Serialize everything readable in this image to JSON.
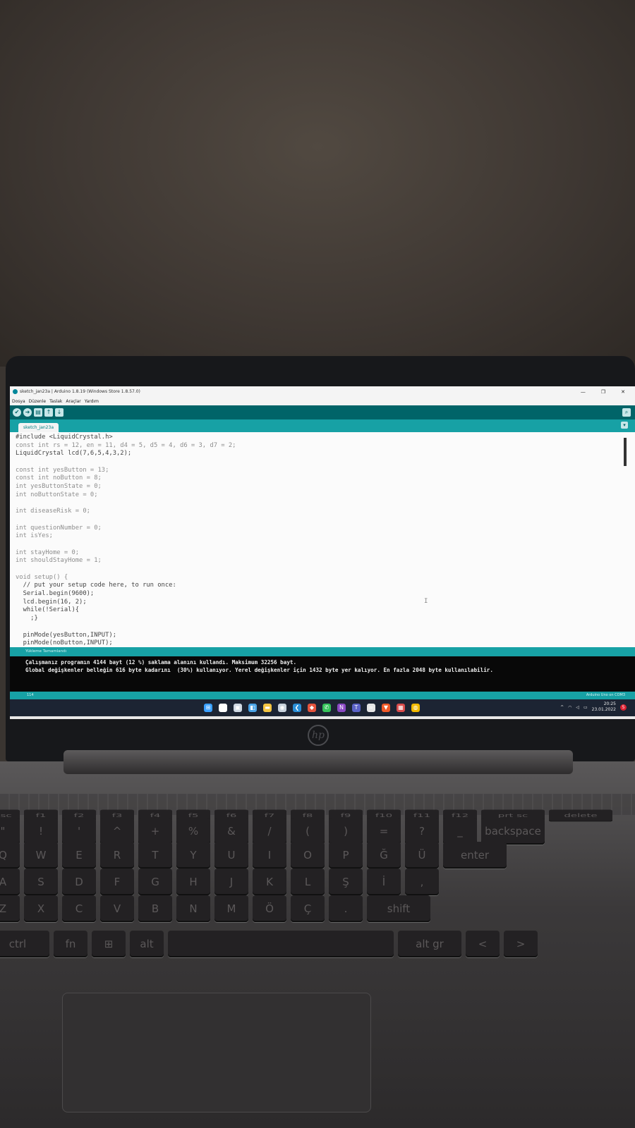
{
  "window": {
    "title": "sketch_jan23a | Arduino 1.8.19 (Windows Store 1.8.57.0)",
    "minimize": "—",
    "maximize": "❐",
    "close": "✕"
  },
  "menu": [
    "Dosya",
    "Düzenle",
    "Taslak",
    "Araçlar",
    "Yardım"
  ],
  "toolbar": {
    "verify_icon": "✔",
    "upload_icon": "➜",
    "new_icon": "▤",
    "open_icon": "↑",
    "save_icon": "↓",
    "serial_icon": "⌕"
  },
  "tab": {
    "label": "sketch_jan23a",
    "menu_icon": "▾"
  },
  "editor": {
    "lines": [
      "#include <LiquidCrystal.h>",
      "const int rs = 12, en = 11, d4 = 5, d5 = 4, d6 = 3, d7 = 2;",
      "LiquidCrystal lcd(7,6,5,4,3,2);",
      "",
      "const int yesButton = 13;",
      "const int noButton = 8;",
      "int yesButtonState = 0;",
      "int noButtonState = 0;",
      "",
      "int diseaseRisk = 0;",
      "",
      "int questionNumber = 0;",
      "int isYes;",
      "",
      "int stayHome = 0;",
      "int shouldStayHome = 1;",
      "",
      "void setup() {",
      "  // put your setup code here, to run once:",
      "  Serial.begin(9600);",
      "  lcd.begin(16, 2);",
      "  while(!Serial){",
      "    ;}",
      "",
      "  pinMode(yesButton,INPUT);",
      "  pinMode(noButton,INPUT);"
    ],
    "cursor_glyph": "I"
  },
  "status": {
    "message": "Yükleme Tamamlandı"
  },
  "console": {
    "lines": [
      "Çalışmanız programın 4144 bayt (12 %) saklama alanını kullandı. Maksimum 32256 bayt.",
      "Global değişkenler belleğin 616 byte kadarını  (30%) kullanıyor. Yerel değişkenler için 1432 byte yer kalıyor. En fazla 2048 byte kullanılabilir."
    ]
  },
  "footer": {
    "line": "114",
    "board": "Arduino Uno on COM3"
  },
  "taskbar": {
    "icons": [
      {
        "name": "windows-start-icon",
        "glyph": "⊞",
        "color": "#3aa0ff"
      },
      {
        "name": "search-icon",
        "glyph": "⌕",
        "color": "#ffffff"
      },
      {
        "name": "task-view-icon",
        "glyph": "▣",
        "color": "#cfd8e3"
      },
      {
        "name": "widgets-icon",
        "glyph": "◧",
        "color": "#4aa3e6"
      },
      {
        "name": "file-explorer-icon",
        "glyph": "▬",
        "color": "#f4c542"
      },
      {
        "name": "steam-icon",
        "glyph": "◉",
        "color": "#c8d2dc"
      },
      {
        "name": "vscode-icon",
        "glyph": "❮",
        "color": "#2a8fd8"
      },
      {
        "name": "app-icon",
        "glyph": "◆",
        "color": "#e5533d"
      },
      {
        "name": "whatsapp-icon",
        "glyph": "✆",
        "color": "#35c35a"
      },
      {
        "name": "onenote-icon",
        "glyph": "N",
        "color": "#8a48c4"
      },
      {
        "name": "teams-icon",
        "glyph": "T",
        "color": "#5b63c8"
      },
      {
        "name": "arduino-icon",
        "glyph": "∞",
        "color": "#e6e6e6"
      },
      {
        "name": "brave-icon",
        "glyph": "▼",
        "color": "#f05a28"
      },
      {
        "name": "app-active-icon",
        "glyph": "▦",
        "color": "#d94b4b"
      },
      {
        "name": "chrome-icon",
        "glyph": "◍",
        "color": "#f2b900"
      }
    ],
    "tray": {
      "chevron": "^",
      "wifi": "◠",
      "volume": "◁",
      "battery": "▭",
      "time": "20:25",
      "date": "23.01.2022",
      "notifications": "5"
    }
  },
  "hardware": {
    "logo": "hp",
    "keyboard_rows": [
      [
        "esc",
        "f1",
        "f2",
        "f3",
        "f4",
        "f5",
        "f6",
        "f7",
        "f8",
        "f9",
        "f10",
        "f11",
        "f12",
        "prt sc",
        "delete"
      ],
      [
        "\"",
        "!",
        "'",
        "^",
        "+",
        "%",
        "&",
        "/",
        "(",
        ")",
        "=",
        "?",
        "_",
        "backspace"
      ],
      [
        "Q",
        "W",
        "E",
        "R",
        "T",
        "Y",
        "U",
        "I",
        "O",
        "P",
        "Ğ",
        "Ü",
        "enter"
      ],
      [
        "A",
        "S",
        "D",
        "F",
        "G",
        "H",
        "J",
        "K",
        "L",
        "Ş",
        "İ",
        ","
      ],
      [
        "Z",
        "X",
        "C",
        "V",
        "B",
        "N",
        "M",
        "Ö",
        "Ç",
        ".",
        "shift"
      ],
      [
        "ctrl",
        "fn",
        "⊞",
        "alt",
        "",
        "alt gr",
        "<",
        ">"
      ]
    ]
  }
}
